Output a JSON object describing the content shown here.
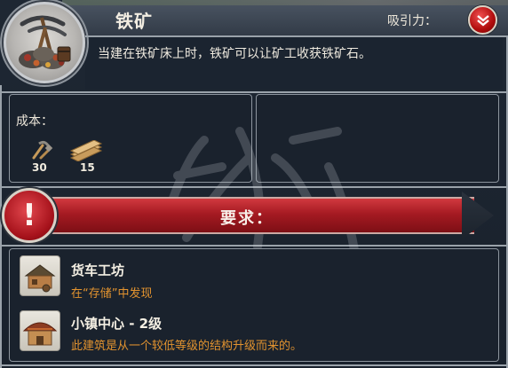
{
  "building": {
    "title": "铁矿",
    "description": "当建在铁矿床上时，铁矿可以让矿工收获铁矿石。",
    "appeal_label": "吸引力："
  },
  "cost": {
    "label": "成本：",
    "resources": [
      {
        "icon": "tools-icon",
        "amount": "30"
      },
      {
        "icon": "planks-icon",
        "amount": "15"
      }
    ]
  },
  "requirements": {
    "title": "要求：",
    "items": [
      {
        "icon": "cart-workshop-icon",
        "name": "货车工坊",
        "detail": "在“存储”中发现"
      },
      {
        "icon": "town-center-icon",
        "name": "小镇中心 - 2级",
        "detail": "此建筑是从一个较低等级的结构升级而来的。"
      }
    ]
  },
  "colors": {
    "accent_red": "#a51a22",
    "detail_orange": "#e2932f",
    "panel_bg": "#1a222d"
  }
}
